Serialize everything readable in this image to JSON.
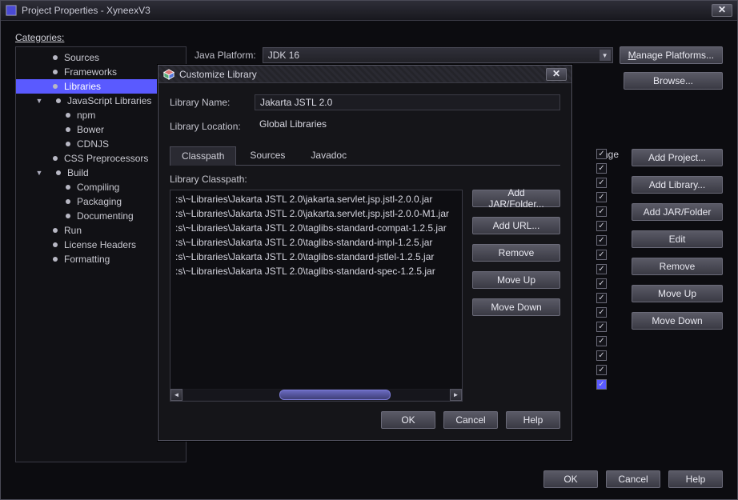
{
  "mainWindow": {
    "title": "Project Properties - XyneexV3",
    "categoriesLabel": "Categories:",
    "tree": [
      {
        "label": "Sources",
        "indent": 1
      },
      {
        "label": "Frameworks",
        "indent": 1
      },
      {
        "label": "Libraries",
        "indent": 1,
        "selected": true
      },
      {
        "label": "JavaScript Libraries",
        "indent": 1,
        "twisty": "▼"
      },
      {
        "label": "npm",
        "indent": 2
      },
      {
        "label": "Bower",
        "indent": 2
      },
      {
        "label": "CDNJS",
        "indent": 2
      },
      {
        "label": "CSS Preprocessors",
        "indent": 1
      },
      {
        "label": "Build",
        "indent": 1,
        "twisty": "▼"
      },
      {
        "label": "Compiling",
        "indent": 2
      },
      {
        "label": "Packaging",
        "indent": 2
      },
      {
        "label": "Documenting",
        "indent": 2
      },
      {
        "label": "Run",
        "indent": 1
      },
      {
        "label": "License Headers",
        "indent": 1
      },
      {
        "label": "Formatting",
        "indent": 1
      }
    ],
    "platform": {
      "label": "Java Platform:",
      "value": "JDK 16"
    },
    "managePlatforms": "Manage Platforms...",
    "browse": "Browse...",
    "packageHeader": "age",
    "rightButtons": {
      "addProject": "Add Project...",
      "addLibrary": "Add Library...",
      "addJar": "Add JAR/Folder",
      "edit": "Edit",
      "remove": "Remove",
      "moveUp": "Move Up",
      "moveDown": "Move Down"
    },
    "bottom": {
      "ok": "OK",
      "cancel": "Cancel",
      "help": "Help"
    }
  },
  "dialog": {
    "title": "Customize Library",
    "libNameLabel": "Library Name:",
    "libName": "Jakarta JSTL 2.0",
    "libLocLabel": "Library Location:",
    "libLoc": "Global Libraries",
    "tabs": {
      "classpath": "Classpath",
      "sources": "Sources",
      "javadoc": "Javadoc"
    },
    "listLabel": "Library Classpath:",
    "classpath": [
      ":s\\~Libraries\\Jakarta JSTL 2.0\\jakarta.servlet.jsp.jstl-2.0.0.jar",
      ":s\\~Libraries\\Jakarta JSTL 2.0\\jakarta.servlet.jsp.jstl-2.0.0-M1.jar",
      ":s\\~Libraries\\Jakarta JSTL 2.0\\taglibs-standard-compat-1.2.5.jar",
      ":s\\~Libraries\\Jakarta JSTL 2.0\\taglibs-standard-impl-1.2.5.jar",
      ":s\\~Libraries\\Jakarta JSTL 2.0\\taglibs-standard-jstlel-1.2.5.jar",
      ":s\\~Libraries\\Jakarta JSTL 2.0\\taglibs-standard-spec-1.2.5.jar"
    ],
    "buttons": {
      "addJar": "Add JAR/Folder...",
      "addUrl": "Add URL...",
      "remove": "Remove",
      "moveUp": "Move Up",
      "moveDown": "Move Down",
      "ok": "OK",
      "cancel": "Cancel",
      "help": "Help"
    }
  }
}
